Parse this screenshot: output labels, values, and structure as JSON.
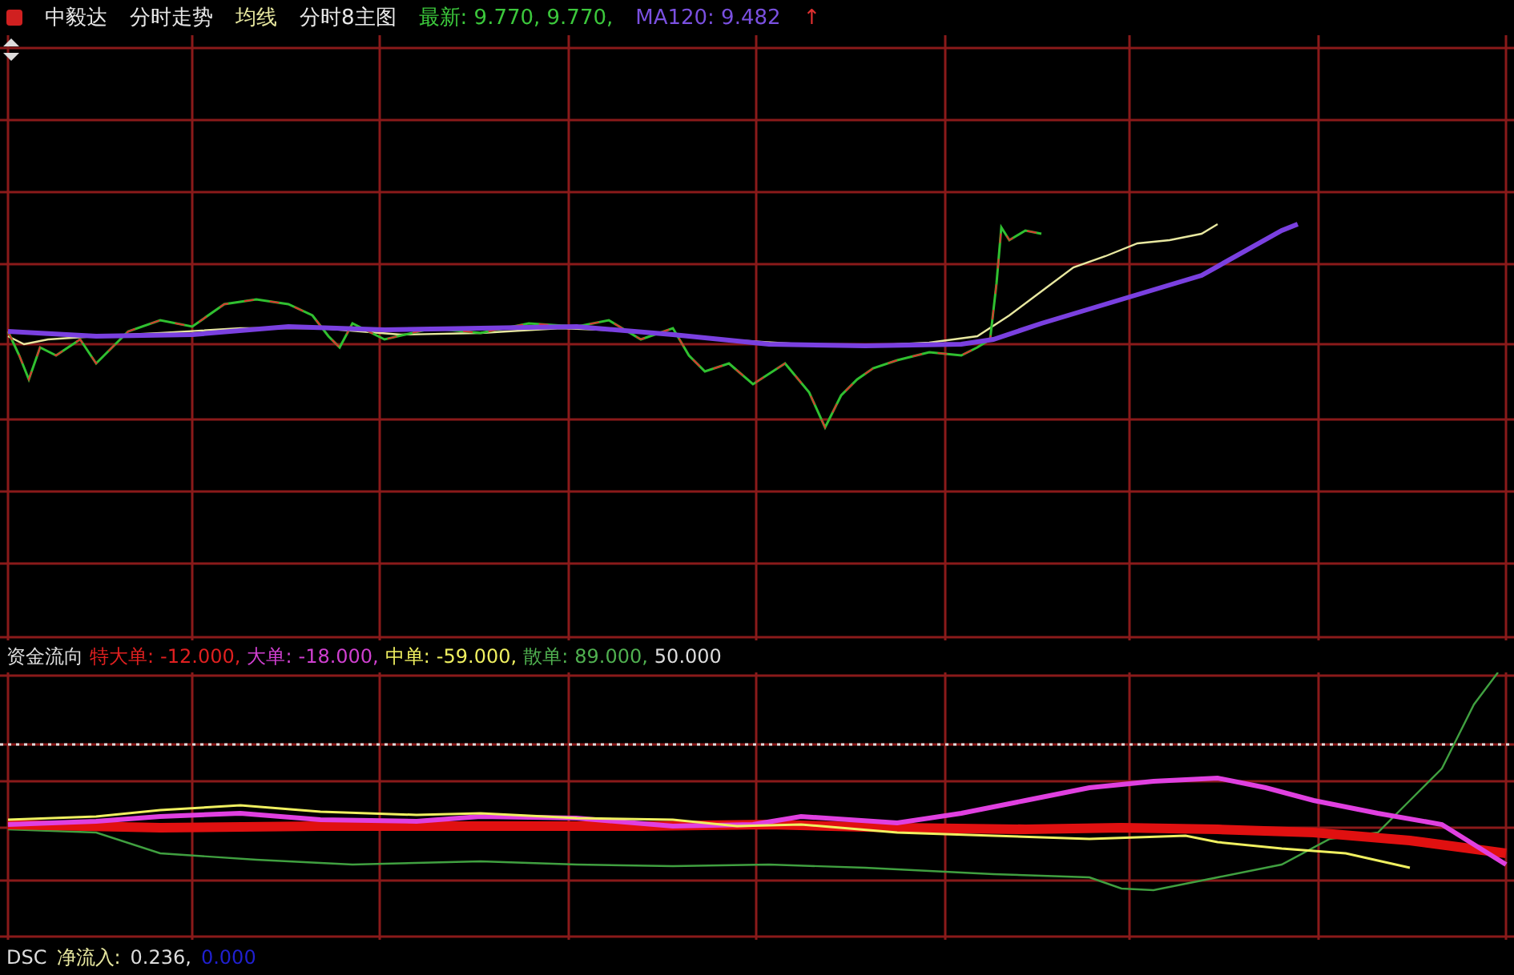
{
  "header": {
    "items": [
      {
        "text": "中毅达",
        "color": "#e8e8e8"
      },
      {
        "text": "分时走势",
        "color": "#e8e8e8"
      },
      {
        "text": "均线",
        "color": "#e8e8a0"
      },
      {
        "text": "分时8主图",
        "color": "#e8e8e8"
      },
      {
        "text": "最新: 9.770, 9.770,",
        "color": "#3cc83c"
      },
      {
        "text": "MA120: 9.482",
        "color": "#7a50e0"
      },
      {
        "text": "↑",
        "color": "#e03030"
      }
    ]
  },
  "indicator": {
    "title": "资金流向",
    "series": [
      {
        "label": "特大单:",
        "value": "-12.000,",
        "color": "#e02020"
      },
      {
        "label": "大单:",
        "value": "-18.000,",
        "color": "#d040d0"
      },
      {
        "label": "中单:",
        "value": "-59.000,",
        "color": "#f0f060"
      },
      {
        "label": "散单:",
        "value": "89.000,",
        "color": "#50b050"
      }
    ],
    "extra": "50.000"
  },
  "footer": {
    "name": "DSC",
    "label": "净流入:",
    "value": "0.236,",
    "value_2": "0.000",
    "color": "#2020d0"
  }
}
